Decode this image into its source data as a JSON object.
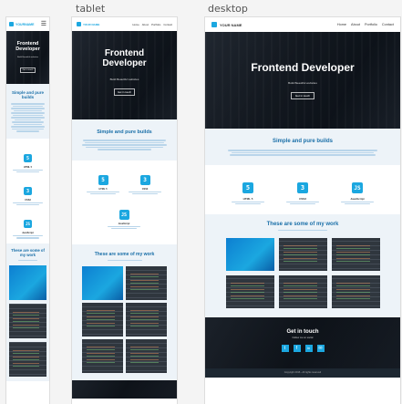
{
  "labels": {
    "tablet": "tablet",
    "desktop": "desktop"
  },
  "brand": {
    "name": "YOUR NAME",
    "mobile_name": "YOURNAME"
  },
  "nav": [
    "Home",
    "About",
    "Portfolio",
    "Contact"
  ],
  "hero": {
    "title_desktop": "Frontend Developer",
    "title_line1": "Frontend",
    "title_line2": "Developer",
    "subtitle": "Build Beautiful websites",
    "button": "Get in touch"
  },
  "about": {
    "title": "Simple and pure builds",
    "title_line1": "Simple and pure",
    "title_line2": "builds"
  },
  "skills": [
    {
      "name": "HTML 5",
      "icon": "5",
      "icon_name": "html5-icon"
    },
    {
      "name": "CSS3",
      "icon": "3",
      "icon_name": "css3-icon"
    },
    {
      "name": "JavaScript",
      "icon": "JS",
      "icon_name": "js-icon"
    }
  ],
  "work": {
    "title": "These are some of my work",
    "title_line1": "These are some of",
    "title_line2": "my work"
  },
  "contact": {
    "title": "Get in touch",
    "subtitle": "Follow me on social"
  },
  "footer": {
    "copyright": "Copyright 2016 - All rights reserved"
  },
  "colors": {
    "accent": "#1ba7e0",
    "heading": "#1a6fa8"
  }
}
